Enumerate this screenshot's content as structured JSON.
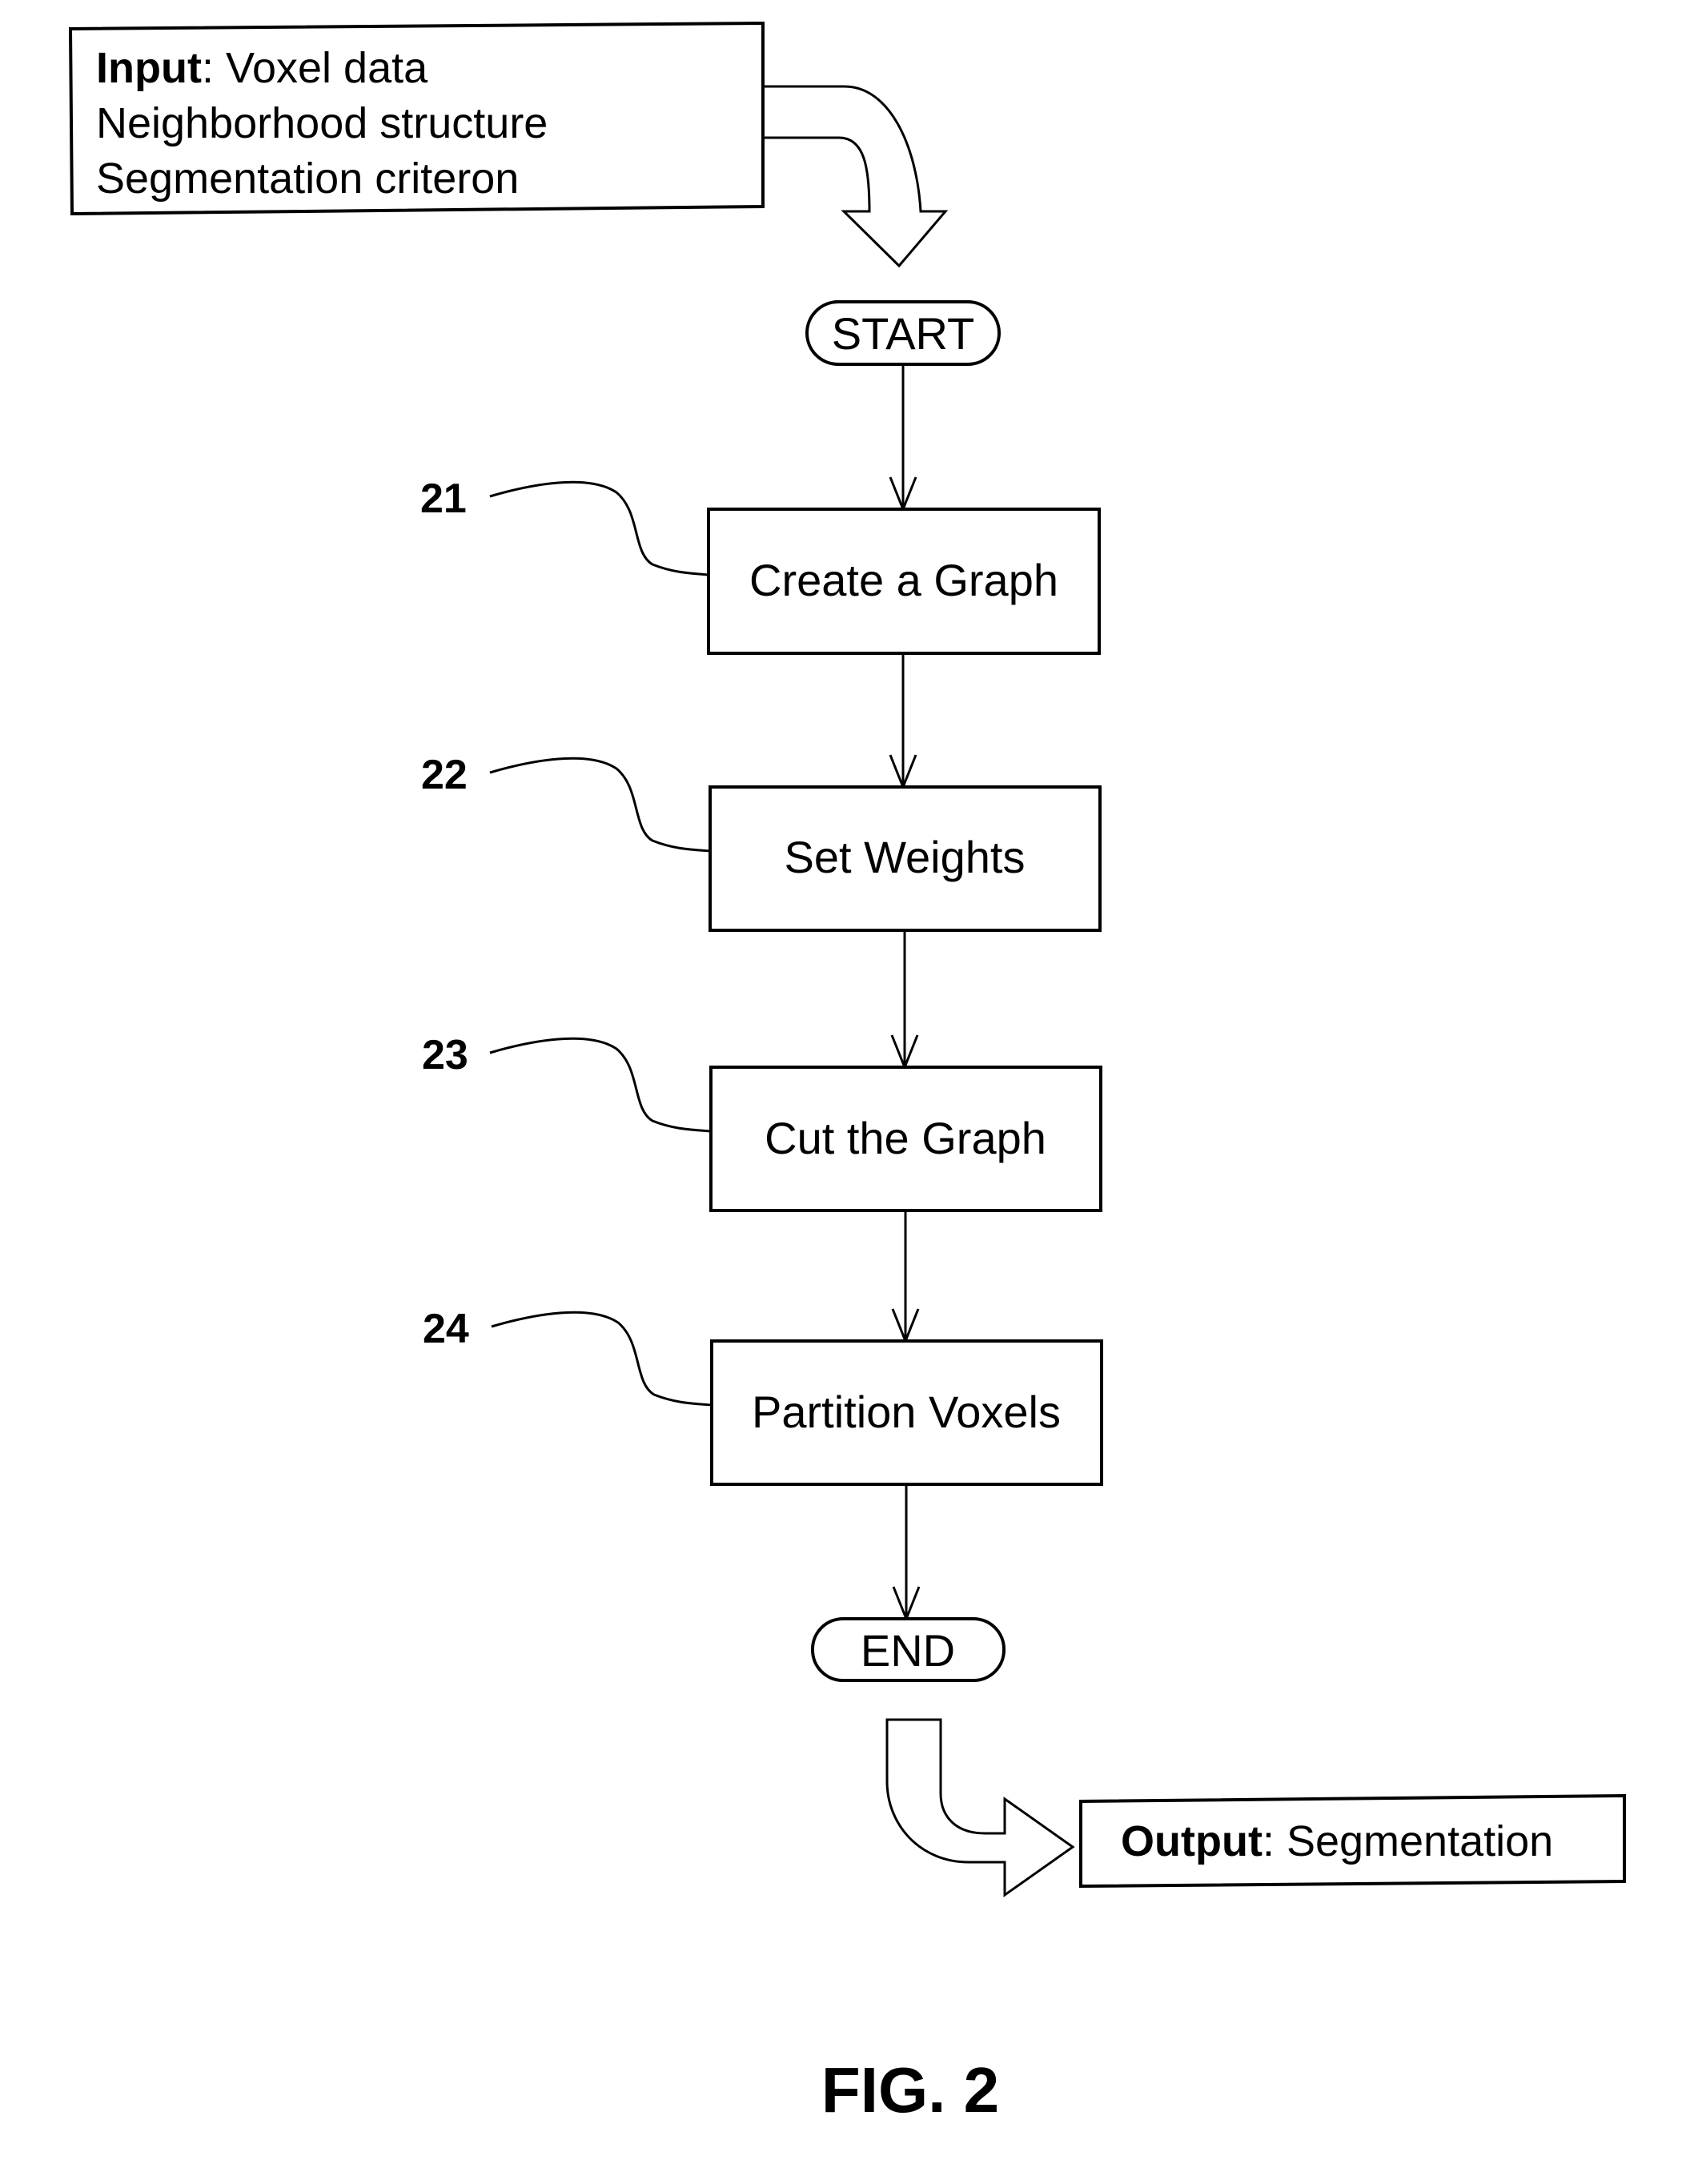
{
  "figure": {
    "caption": "FIG. 2",
    "colors": {
      "ink": "#000000",
      "paper": "#ffffff"
    }
  },
  "input": {
    "label_bold": "Input",
    "lines": [
      {
        "bold": "Input",
        "text": ": Voxel data"
      },
      {
        "text": "Neighborhood structure"
      },
      {
        "text": "Segmentation criteron"
      }
    ]
  },
  "start": {
    "label": "START"
  },
  "steps": [
    {
      "ref": "21",
      "label": "Create a Graph"
    },
    {
      "ref": "22",
      "label": "Set Weights"
    },
    {
      "ref": "23",
      "label": "Cut the Graph"
    },
    {
      "ref": "24",
      "label": "Partition Voxels"
    }
  ],
  "end": {
    "label": "END"
  },
  "output": {
    "label_bold": "Output",
    "label_rest": ": Segmentation"
  }
}
